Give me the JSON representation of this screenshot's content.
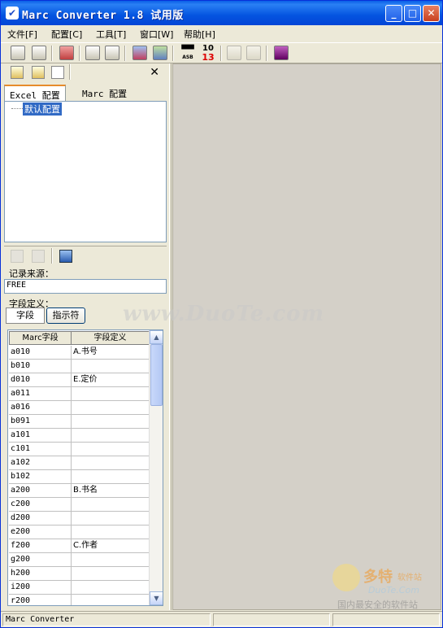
{
  "window": {
    "title": "Marc Converter 1.8 试用版",
    "minimize": "_",
    "maximize": "□",
    "close": "✕"
  },
  "menu": [
    "文件[F]",
    "配置[C]",
    "工具[T]",
    "窗口[W]",
    "帮助[H]"
  ],
  "toolbar_icons": [
    "open-icon",
    "import-icon",
    "book-icon",
    "copy-icon",
    "paste-icon",
    "table-icon",
    "convert-icon",
    "binoculars-icon",
    "counter-icon",
    "disabled-1-icon",
    "disabled-2-icon",
    "book-stack-icon"
  ],
  "toolbar_text": {
    "binoculars": "ASB",
    "counter_top": "10",
    "counter_bottom": "13"
  },
  "left_panel": {
    "close": "✕",
    "tabs": [
      "Excel 配置",
      "Marc 配置"
    ],
    "tree_node": "默认配置",
    "record_source_label": "记录来源：",
    "record_source_value": "FREE",
    "field_def_label": "字段定义：",
    "seg_tabs": [
      "字段",
      "指示符"
    ],
    "grid": {
      "headers": [
        "Marc字段",
        "字段定义"
      ],
      "rows": [
        [
          "a010",
          "A.书号"
        ],
        [
          "b010",
          ""
        ],
        [
          "d010",
          "E.定价"
        ],
        [
          "a011",
          ""
        ],
        [
          "a016",
          ""
        ],
        [
          "b091",
          ""
        ],
        [
          "a101",
          ""
        ],
        [
          "c101",
          ""
        ],
        [
          "a102",
          ""
        ],
        [
          "b102",
          ""
        ],
        [
          "a200",
          "B.书名"
        ],
        [
          "c200",
          ""
        ],
        [
          "d200",
          ""
        ],
        [
          "e200",
          ""
        ],
        [
          "f200",
          "C.作者"
        ],
        [
          "g200",
          ""
        ],
        [
          "h200",
          ""
        ],
        [
          "i200",
          ""
        ],
        [
          "r200",
          ""
        ]
      ]
    }
  },
  "status": {
    "text": "Marc Converter"
  },
  "watermark": {
    "site": "www.DuoTe.com",
    "logo_big": "多特",
    "logo_small": "软件站",
    "logo_url": "DuoTe.Com",
    "slogan": "国内最安全的软件站"
  }
}
